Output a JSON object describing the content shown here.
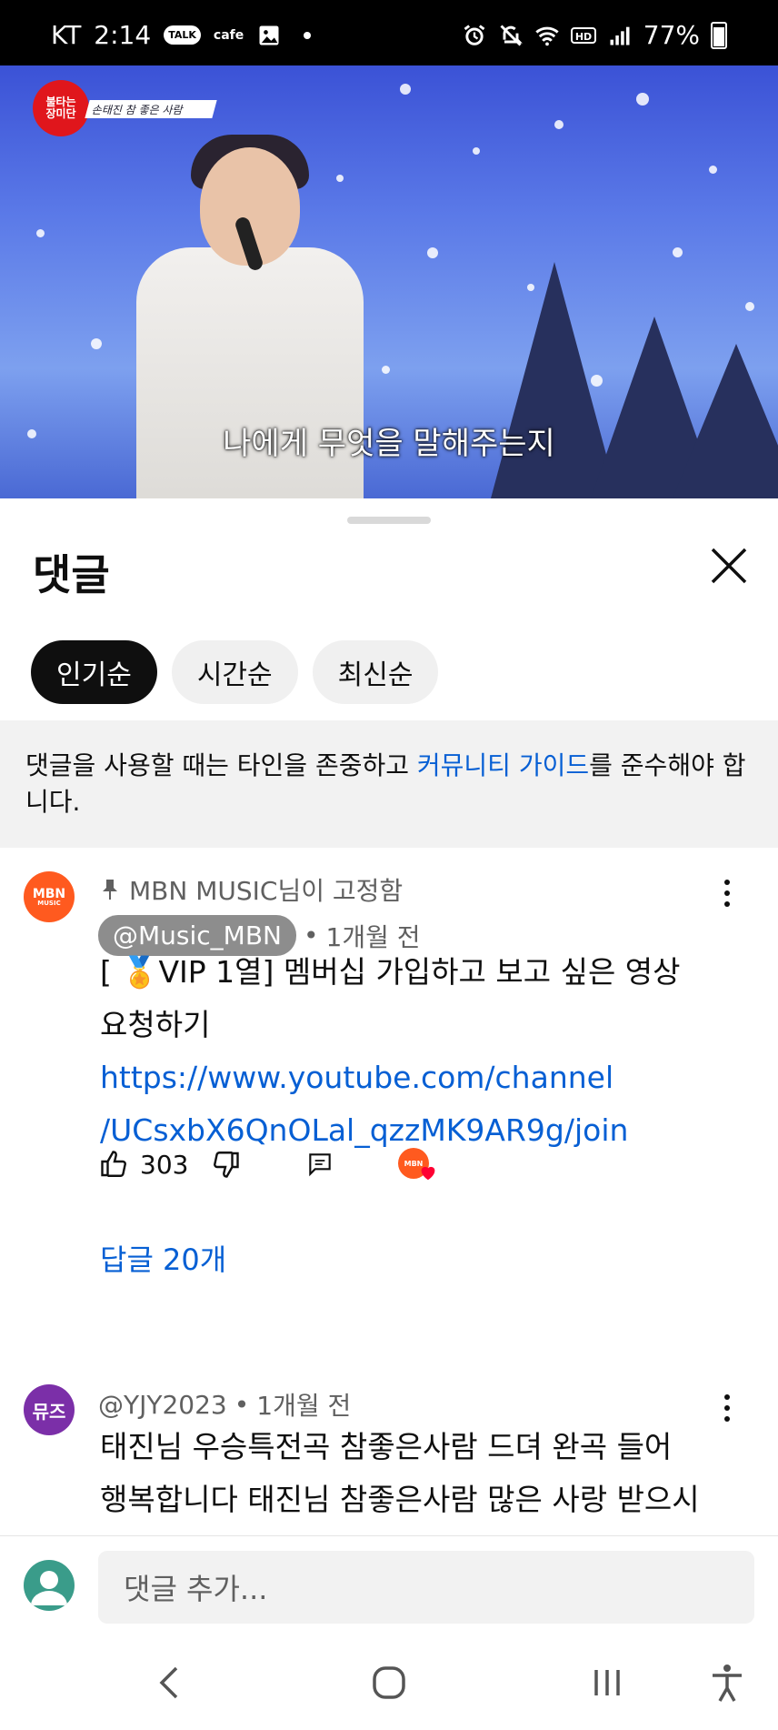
{
  "status_bar": {
    "carrier": "KT",
    "time": "2:14",
    "talk_badge": "TALK",
    "cafe": "cafe",
    "battery": "77%"
  },
  "video": {
    "logo_text": "불타는\n장미단",
    "logo_caption": "손태진 참 좋은 사람",
    "subtitle": "나에게 무엇을 말해주는지",
    "progress_fraction": 0.41
  },
  "sheet": {
    "title": "댓글",
    "chips": [
      "인기순",
      "시간순",
      "최신순"
    ],
    "active_chip": 0,
    "notice_before": "댓글을 사용할 때는 타인을 존중하고 ",
    "notice_link": "커뮤니티 가이드",
    "notice_after": "를 준수해야 합니다."
  },
  "comments": [
    {
      "avatar_text": "MBN",
      "avatar_sub": "MUSIC",
      "avatar_color": "#ff5a1f",
      "pinned_text": "MBN MUSIC님이 고정함",
      "author": "@Music_MBN",
      "time": "1개월 전",
      "body_line1": "[ 🏅VIP 1열] 멤버십 가입하고 보고 싶은 영상",
      "body_line2": "요청하기",
      "url_line1": "https://www.youtube.com/channel",
      "url_line2": "/UCsxbX6QnOLal_qzzMK9AR9g/join",
      "likes": "303",
      "replies": "답글 20개"
    },
    {
      "avatar_text": "뮤즈",
      "avatar_color": "#7b2fa8",
      "author": "@YJY2023",
      "time": "1개월 전",
      "body_line1": "태진님 우승특전곡 참좋은사람 드뎌 완곡 들어",
      "body_line2": "행복합니다 태진님 참좋은사람 많은 사랑 받으시길"
    }
  ],
  "input": {
    "placeholder": "댓글 추가..."
  }
}
